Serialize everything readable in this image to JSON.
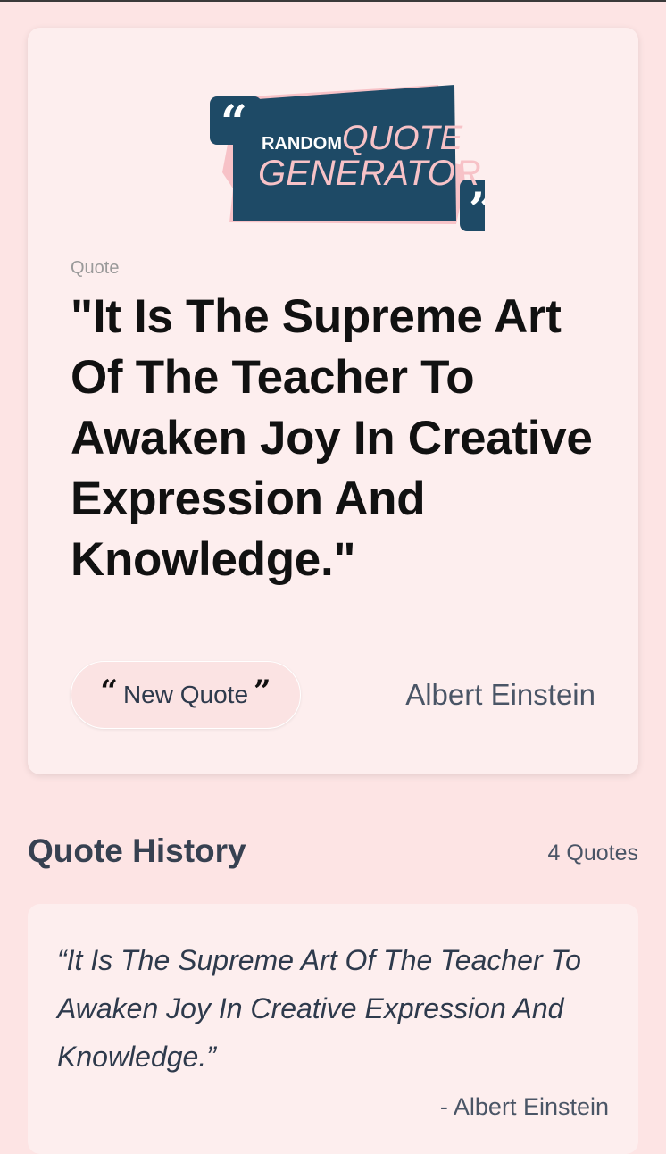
{
  "logo": {
    "word1": "RANDOM",
    "word2": "QUOTE",
    "word3": "GENERATOR",
    "open_mark": "“",
    "close_mark": "”",
    "colors": {
      "panel": "#1e4a66",
      "accent": "#f7c2c7"
    }
  },
  "main": {
    "quote_label": "Quote",
    "quote_text": "\"It Is The Supreme Art Of The Teacher To Awaken Joy In Creative Expression And Knowledge.\"",
    "new_quote_button": {
      "open_mark": "“",
      "label": "New Quote",
      "close_mark": "”"
    },
    "author": "Albert Einstein"
  },
  "history": {
    "title": "Quote History",
    "count_label": "4 Quotes",
    "items": [
      {
        "text": "“It Is The Supreme Art Of The Teacher To Awaken Joy In Creative Expression And Knowledge.”",
        "author": "- Albert Einstein"
      }
    ]
  }
}
